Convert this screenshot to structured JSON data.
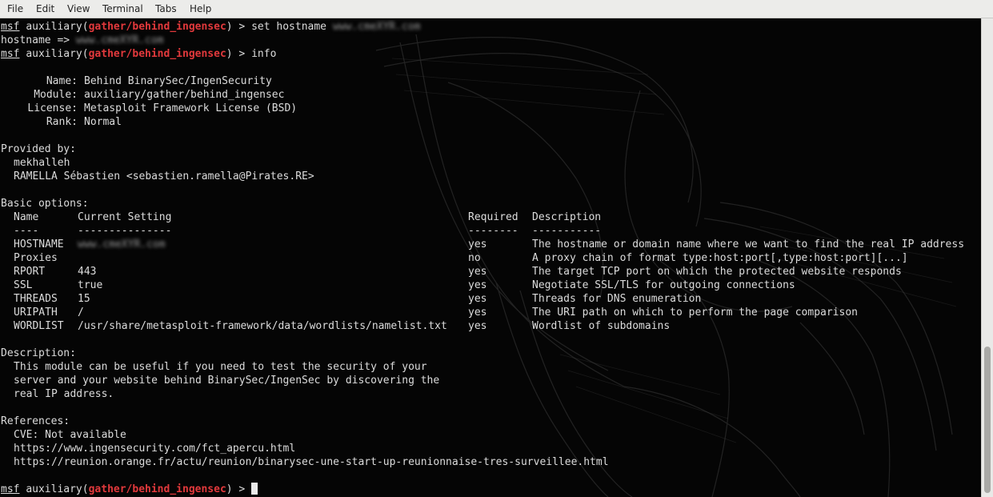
{
  "menu": [
    "File",
    "Edit",
    "View",
    "Terminal",
    "Tabs",
    "Help"
  ],
  "prompt": {
    "user": "msf",
    "word": "auxiliary(",
    "module": "gather/behind_ingensec",
    "suffix": ") > "
  },
  "cmd1": "set hostname",
  "redacted_host": "www.cmeXYR.com",
  "out_hostname": "hostname => ",
  "cmd2": "info",
  "info": [
    {
      "label": "Name:",
      "value": "Behind BinarySec/IngenSecurity"
    },
    {
      "label": "Module:",
      "value": "auxiliary/gather/behind_ingensec"
    },
    {
      "label": "License:",
      "value": "Metasploit Framework License (BSD)"
    },
    {
      "label": "Rank:",
      "value": "Normal"
    }
  ],
  "provided_by": {
    "heading": "Provided by:",
    "authors": [
      "mekhalleh",
      "RAMELLA Sébastien <sebastien.ramella@Pirates.RE>"
    ]
  },
  "options": {
    "heading": "Basic options:",
    "headers": [
      "Name",
      "Current Setting",
      "Required",
      "Description"
    ],
    "dashes": [
      "----",
      "---------------",
      "--------",
      "-----------"
    ],
    "rows": [
      {
        "name": "HOSTNAME",
        "setting": "www.cmeXYR.com",
        "required": "yes",
        "desc": "The hostname or domain name where we want to find the real IP address"
      },
      {
        "name": "Proxies",
        "setting": "",
        "required": "no",
        "desc": "A proxy chain of format type:host:port[,type:host:port][...]"
      },
      {
        "name": "RPORT",
        "setting": "443",
        "required": "yes",
        "desc": "The target TCP port on which the protected website responds"
      },
      {
        "name": "SSL",
        "setting": "true",
        "required": "yes",
        "desc": "Negotiate SSL/TLS for outgoing connections"
      },
      {
        "name": "THREADS",
        "setting": "15",
        "required": "yes",
        "desc": "Threads for DNS enumeration"
      },
      {
        "name": "URIPATH",
        "setting": "/",
        "required": "yes",
        "desc": "The URI path on which to perform the page comparison"
      },
      {
        "name": "WORDLIST",
        "setting": "/usr/share/metasploit-framework/data/wordlists/namelist.txt",
        "required": "yes",
        "desc": "Wordlist of subdomains"
      }
    ]
  },
  "description": {
    "heading": "Description:",
    "lines": [
      "This module can be useful if you need to test the security of your",
      "server and your website behind BinarySec/IngenSec by discovering the",
      "real IP address."
    ]
  },
  "references": {
    "heading": "References:",
    "items": [
      "CVE: Not available",
      "https://www.ingensecurity.com/fct_apercu.html",
      "https://reunion.orange.fr/actu/reunion/binarysec-une-start-up-reunionnaise-tres-surveillee.html"
    ]
  },
  "colors": {
    "module": "#e2393c",
    "text": "#dcdcdc",
    "background": "#050505"
  }
}
